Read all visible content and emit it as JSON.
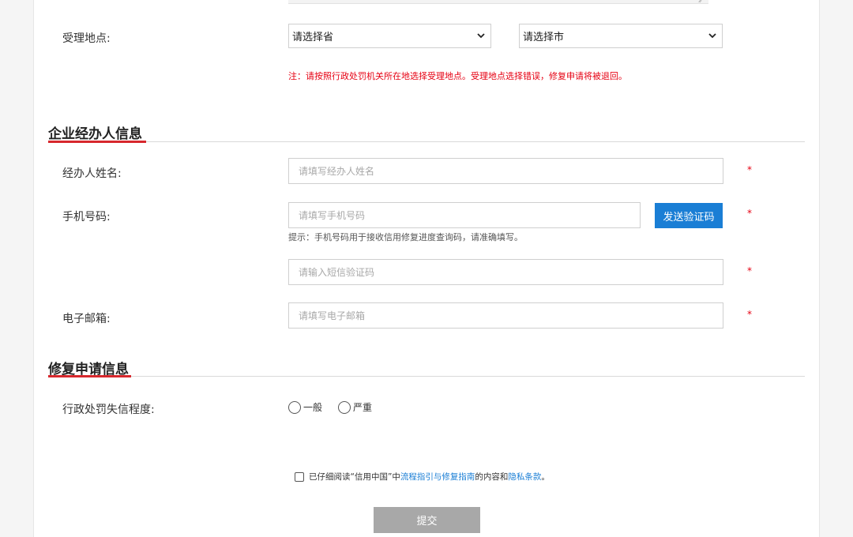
{
  "location": {
    "label": "受理地点:",
    "province_select": "请选择省",
    "city_select": "请选择市",
    "note": "注：请按照行政处罚机关所在地选择受理地点。受理地点选择错误，修复申请将被退回。"
  },
  "agent_section": {
    "title": "企业经办人信息",
    "name_label": "经办人姓名:",
    "name_placeholder": "请填写经办人姓名",
    "phone_label": "手机号码:",
    "phone_placeholder": "请填写手机号码",
    "send_code_button": "发送验证码",
    "phone_hint": "提示：手机号码用于接收信用修复进度查询码，请准确填写。",
    "code_placeholder": "请输入短信验证码",
    "email_label": "电子邮箱:",
    "email_placeholder": "请填写电子邮箱",
    "required_mark": "*"
  },
  "repair_section": {
    "title": "修复申请信息",
    "severity_label": "行政处罚失信程度:",
    "options": [
      "一般",
      "严重"
    ]
  },
  "agreement": {
    "prefix": "已仔细阅读“信用中国”中",
    "link1": "流程指引与修复指南",
    "middle": "的内容和",
    "link2": "隐私条款",
    "suffix": "。"
  },
  "submit_button": "提交",
  "colors": {
    "accent_blue": "#1a7ed5",
    "required_red": "#e60012",
    "section_underline": "#d7282d",
    "submit_disabled": "#a8a8a8"
  }
}
